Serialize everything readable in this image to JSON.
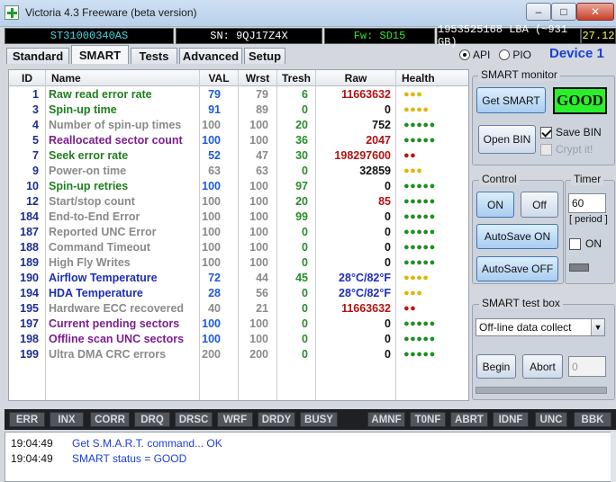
{
  "window": {
    "title": "Victoria 4.3 Freeware (beta version)",
    "minimize_glyph": "–",
    "maximize_glyph": "□",
    "close_glyph": "✕"
  },
  "info_bar": {
    "model": "ST31000340AS",
    "serial": "SN: 9QJ17Z4X",
    "firmware": "Fw: SD15",
    "lba": "1953525168 LBA (~931 GB)",
    "clock": "27.12"
  },
  "tabs": [
    {
      "label": "Standard"
    },
    {
      "label": "SMART",
      "active": true
    },
    {
      "label": "Tests"
    },
    {
      "label": "Advanced"
    },
    {
      "label": "Setup"
    }
  ],
  "mode": {
    "api_label": "API",
    "pio_label": "PIO",
    "selected": "API"
  },
  "device_label": "Device 1",
  "table": {
    "headers": [
      "ID",
      "Name",
      "VAL",
      "Wrst",
      "Tresh",
      "Raw",
      "Health"
    ],
    "rows": [
      {
        "id": "1",
        "name": "Raw read error rate",
        "val": "79",
        "wrst": "79",
        "tresh": "6",
        "raw": "11663632",
        "health": "●●●",
        "name_color": "green",
        "raw_color": "red",
        "health_color": "#e3b400"
      },
      {
        "id": "3",
        "name": "Spin-up time",
        "val": "91",
        "wrst": "89",
        "tresh": "0",
        "raw": "0",
        "health": "●●●●",
        "name_color": "green",
        "raw_color": "black",
        "health_color": "#e3b400"
      },
      {
        "id": "4",
        "name": "Number of spin-up times",
        "val": "100",
        "wrst": "100",
        "tresh": "20",
        "raw": "752",
        "health": "●●●●●",
        "name_color": "gray",
        "raw_color": "black",
        "health_color": "#1f8f1f"
      },
      {
        "id": "5",
        "name": "Reallocated sector count",
        "val": "100",
        "wrst": "100",
        "tresh": "36",
        "raw": "2047",
        "health": "●●●●●",
        "name_color": "purple",
        "raw_color": "red",
        "health_color": "#1f8f1f"
      },
      {
        "id": "7",
        "name": "Seek error rate",
        "val": "52",
        "wrst": "47",
        "tresh": "30",
        "raw": "198297600",
        "health": "●●",
        "name_color": "green",
        "raw_color": "red",
        "health_color": "#c01414"
      },
      {
        "id": "9",
        "name": "Power-on time",
        "val": "63",
        "wrst": "63",
        "tresh": "0",
        "raw": "32859",
        "health": "●●●",
        "name_color": "gray",
        "raw_color": "black",
        "health_color": "#e3b400"
      },
      {
        "id": "10",
        "name": "Spin-up retries",
        "val": "100",
        "wrst": "100",
        "tresh": "97",
        "raw": "0",
        "health": "●●●●●",
        "name_color": "green",
        "raw_color": "black",
        "health_color": "#1f8f1f"
      },
      {
        "id": "12",
        "name": "Start/stop count",
        "val": "100",
        "wrst": "100",
        "tresh": "20",
        "raw": "85",
        "health": "●●●●●",
        "name_color": "gray",
        "raw_color": "red",
        "health_color": "#1f8f1f"
      },
      {
        "id": "184",
        "name": "End-to-End Error",
        "val": "100",
        "wrst": "100",
        "tresh": "99",
        "raw": "0",
        "health": "●●●●●",
        "name_color": "gray",
        "raw_color": "black",
        "health_color": "#1f8f1f"
      },
      {
        "id": "187",
        "name": "Reported UNC Error",
        "val": "100",
        "wrst": "100",
        "tresh": "0",
        "raw": "0",
        "health": "●●●●●",
        "name_color": "gray",
        "raw_color": "black",
        "health_color": "#1f8f1f"
      },
      {
        "id": "188",
        "name": "Command Timeout",
        "val": "100",
        "wrst": "100",
        "tresh": "0",
        "raw": "0",
        "health": "●●●●●",
        "name_color": "gray",
        "raw_color": "black",
        "health_color": "#1f8f1f"
      },
      {
        "id": "189",
        "name": "High Fly Writes",
        "val": "100",
        "wrst": "100",
        "tresh": "0",
        "raw": "0",
        "health": "●●●●●",
        "name_color": "gray",
        "raw_color": "black",
        "health_color": "#1f8f1f"
      },
      {
        "id": "190",
        "name": "Airflow Temperature",
        "val": "72",
        "wrst": "44",
        "tresh": "45",
        "raw": "28°C/82°F",
        "health": "●●●●",
        "name_color": "blue",
        "raw_color": "blue",
        "health_color": "#e3b400"
      },
      {
        "id": "194",
        "name": "HDA Temperature",
        "val": "28",
        "wrst": "56",
        "tresh": "0",
        "raw": "28°C/82°F",
        "health": "●●●",
        "name_color": "blue",
        "raw_color": "blue",
        "health_color": "#e3b400"
      },
      {
        "id": "195",
        "name": "Hardware ECC recovered",
        "val": "40",
        "wrst": "21",
        "tresh": "0",
        "raw": "11663632",
        "health": "●●",
        "name_color": "gray",
        "raw_color": "red",
        "health_color": "#c01414"
      },
      {
        "id": "197",
        "name": "Current pending sectors",
        "val": "100",
        "wrst": "100",
        "tresh": "0",
        "raw": "0",
        "health": "●●●●●",
        "name_color": "purple",
        "raw_color": "black",
        "health_color": "#1f8f1f"
      },
      {
        "id": "198",
        "name": "Offline scan UNC sectors",
        "val": "100",
        "wrst": "100",
        "tresh": "0",
        "raw": "0",
        "health": "●●●●●",
        "name_color": "purple",
        "raw_color": "black",
        "health_color": "#1f8f1f"
      },
      {
        "id": "199",
        "name": "Ultra DMA CRC errors",
        "val": "200",
        "wrst": "200",
        "tresh": "0",
        "raw": "0",
        "health": "●●●●●",
        "name_color": "gray",
        "raw_color": "black",
        "health_color": "#1f8f1f"
      }
    ]
  },
  "smart_monitor": {
    "group_label": "SMART monitor",
    "get_smart_label": "Get SMART",
    "status": "GOOD",
    "open_bin_label": "Open BIN",
    "save_bin_label": "Save BIN",
    "save_bin_checked": true,
    "crypt_label": "Crypt it!",
    "crypt_checked": false
  },
  "control": {
    "group_label": "Control",
    "on_label": "ON",
    "off_label": "Off",
    "autosave_on_label": "AutoSave ON",
    "autosave_off_label": "AutoSave OFF"
  },
  "timer": {
    "group_label": "Timer",
    "value": "60",
    "period_label": "[ period ]",
    "on_label": "ON",
    "on_checked": false
  },
  "test_box": {
    "group_label": "SMART test box",
    "selected_test": "Off-line data collect",
    "begin_label": "Begin",
    "abort_label": "Abort",
    "value": "0"
  },
  "indicators": [
    {
      "label": "ERR"
    },
    {
      "label": "INX"
    },
    {
      "label": "CORR"
    },
    {
      "label": "DRQ"
    },
    {
      "label": "DRSC"
    },
    {
      "label": "WRF"
    },
    {
      "label": "DRDY"
    },
    {
      "label": "BUSY"
    },
    {
      "label": "AMNF"
    },
    {
      "label": "T0NF"
    },
    {
      "label": "ABRT"
    },
    {
      "label": "IDNF"
    },
    {
      "label": "UNC"
    },
    {
      "label": "BBK"
    }
  ],
  "log": [
    {
      "time": "19:04:49",
      "message": "Get S.M.A.R.T. command... OK"
    },
    {
      "time": "19:04:49",
      "message": "SMART status = GOOD"
    }
  ]
}
